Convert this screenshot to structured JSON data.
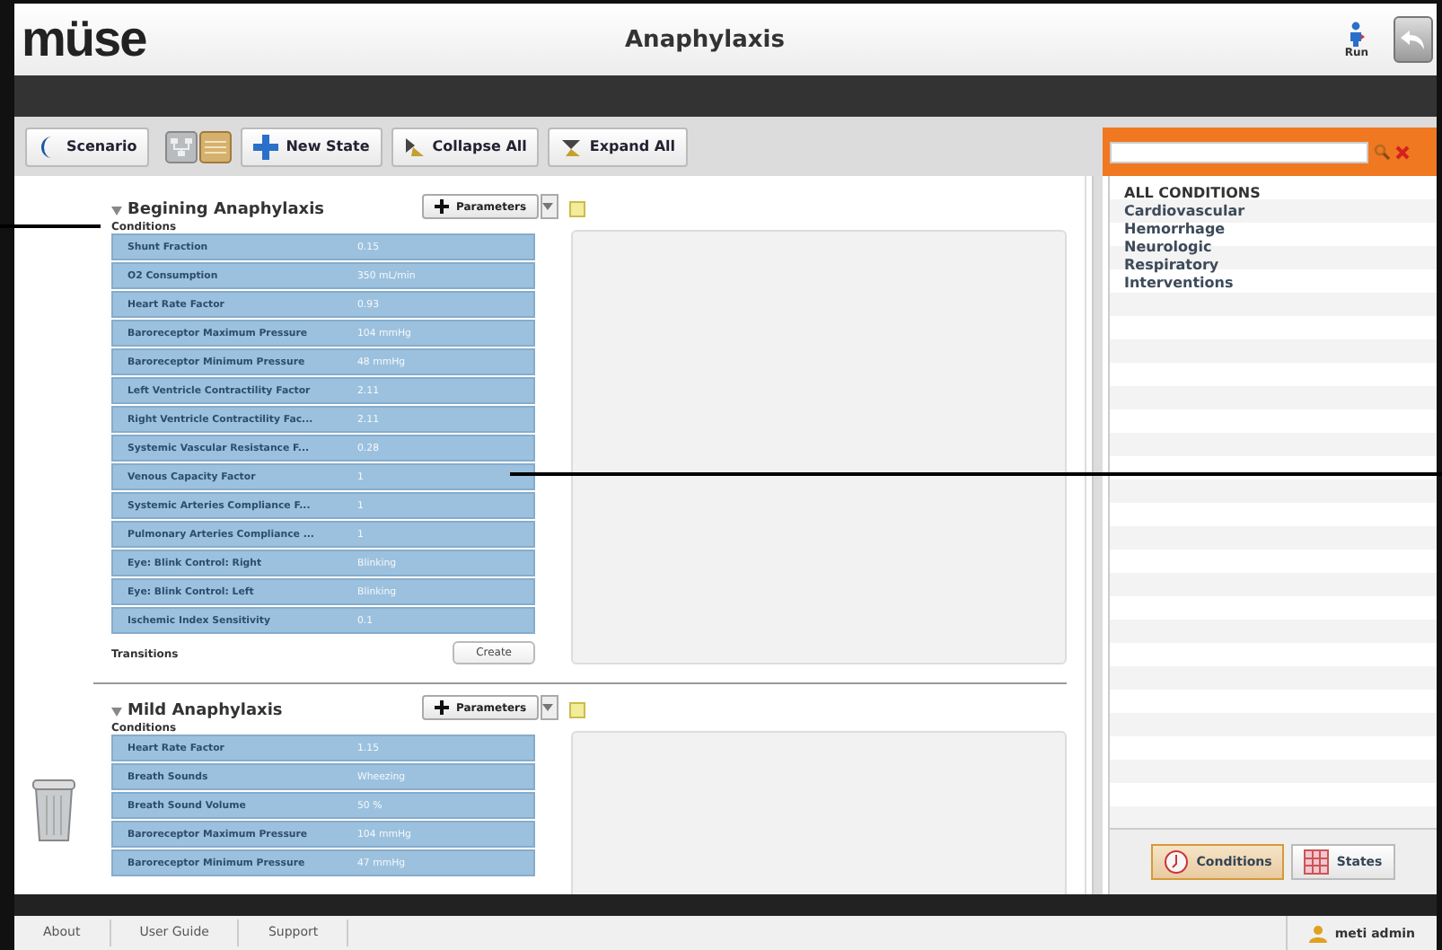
{
  "header": {
    "logo": "müse",
    "title": "Anaphylaxis",
    "run_label": "Run"
  },
  "toolbar": {
    "buttons": [
      {
        "kind": "scenario",
        "label": "Scenario"
      },
      {
        "kind": "graph-view"
      },
      {
        "kind": "list-view"
      },
      {
        "kind": "new",
        "label": "New State"
      },
      {
        "kind": "collapse",
        "label": "Collapse All"
      },
      {
        "kind": "expand",
        "label": "Expand All"
      }
    ]
  },
  "states": [
    {
      "title": "Begining Anaphylaxis",
      "expanded": true,
      "parameters_label": "Parameters",
      "conditions_label": "Conditions",
      "conditions": [
        {
          "name": "Shunt Fraction",
          "value": "0.15"
        },
        {
          "name": "O2 Consumption",
          "value": "350 mL/min"
        },
        {
          "name": "Heart Rate Factor",
          "value": "0.93"
        },
        {
          "name": "Baroreceptor Maximum Pressure",
          "value": "104 mmHg"
        },
        {
          "name": "Baroreceptor Minimum Pressure",
          "value": "48 mmHg"
        },
        {
          "name": "Left Ventricle Contractility Factor",
          "value": "2.11"
        },
        {
          "name": "Right Ventricle Contractility Fac...",
          "value": "2.11"
        },
        {
          "name": "Systemic Vascular Resistance F...",
          "value": "0.28"
        },
        {
          "name": "Venous Capacity Factor",
          "value": "1"
        },
        {
          "name": "Systemic Arteries Compliance F...",
          "value": "1"
        },
        {
          "name": "Pulmonary Arteries Compliance ...",
          "value": "1"
        },
        {
          "name": "Eye: Blink Control: Right",
          "value": "Blinking"
        },
        {
          "name": "Eye: Blink Control: Left",
          "value": "Blinking"
        },
        {
          "name": "Ischemic Index Sensitivity",
          "value": "0.1"
        }
      ],
      "transitions_label": "Transitions",
      "create_label": "Create"
    },
    {
      "title": "Mild Anaphylaxis",
      "expanded": true,
      "parameters_label": "Parameters",
      "conditions_label": "Conditions",
      "conditions": [
        {
          "name": "Heart Rate Factor",
          "value": "1.15"
        },
        {
          "name": "Breath Sounds",
          "value": "Wheezing"
        },
        {
          "name": "Breath Sound Volume",
          "value": "50 %"
        },
        {
          "name": "Baroreceptor Maximum Pressure",
          "value": "104 mmHg"
        },
        {
          "name": "Baroreceptor Minimum Pressure",
          "value": "47 mmHg"
        }
      ]
    }
  ],
  "side_panel": {
    "heading": "ALL CONDITIONS",
    "categories": [
      "Cardiovascular",
      "Hemorrhage",
      "Neurologic",
      "Respiratory",
      "Interventions"
    ],
    "tabs": [
      {
        "label": "Conditions",
        "selected": true
      },
      {
        "label": "States",
        "selected": false
      }
    ]
  },
  "footer": {
    "links": [
      "About",
      "User Guide",
      "Support"
    ],
    "user": "meti admin"
  }
}
